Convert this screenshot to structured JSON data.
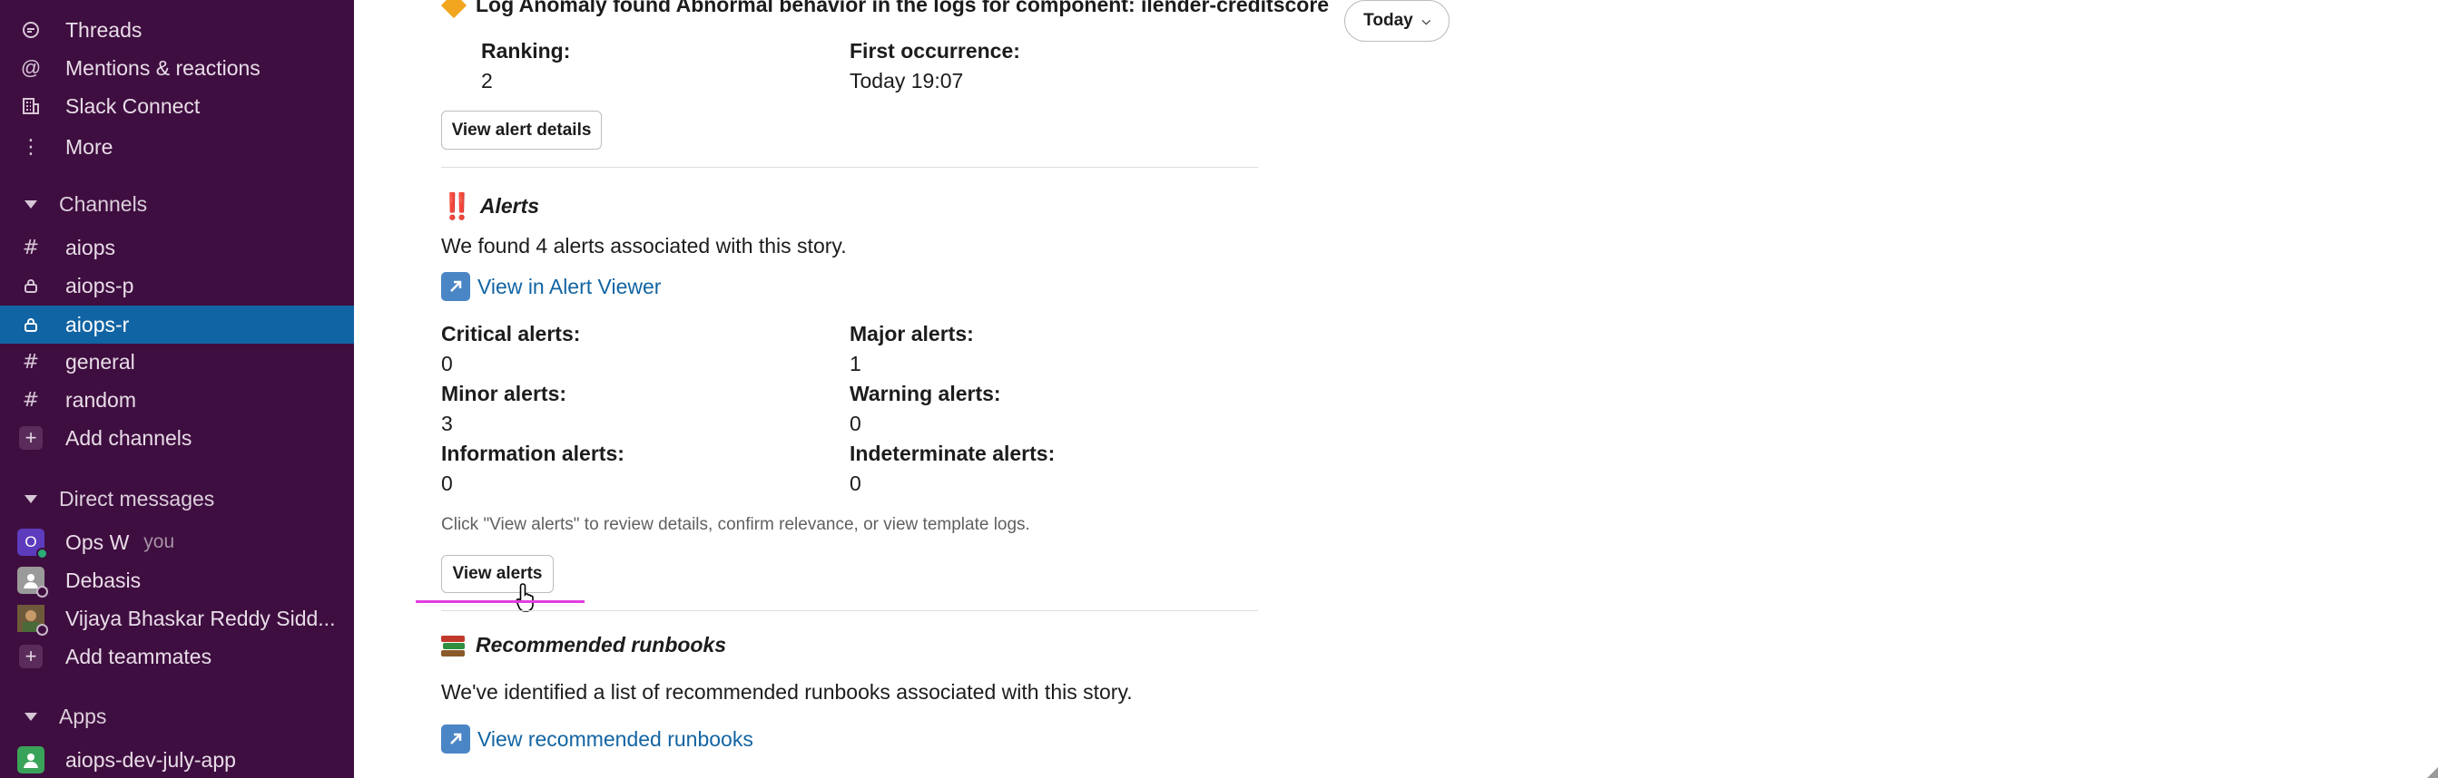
{
  "sidebar": {
    "top_items": [
      {
        "label": "Threads",
        "icon": "threads-icon"
      },
      {
        "label": "Mentions & reactions",
        "icon": "at-icon"
      },
      {
        "label": "Slack Connect",
        "icon": "building-icon"
      },
      {
        "label": "More",
        "icon": "more-vertical-icon"
      }
    ],
    "channels_header": "Channels",
    "channels": [
      {
        "name": "aiops",
        "type": "public"
      },
      {
        "name": "aiops-p",
        "type": "private"
      },
      {
        "name": "aiops-r",
        "type": "private",
        "active": true
      },
      {
        "name": "general",
        "type": "public"
      },
      {
        "name": "random",
        "type": "public"
      }
    ],
    "add_channels": "Add channels",
    "dm_header": "Direct messages",
    "dms": [
      {
        "name": "Ops W",
        "suffix": "you",
        "avatar_letter": "O"
      },
      {
        "name": "Debasis"
      },
      {
        "name": "Vijaya Bhaskar Reddy Sidd..."
      }
    ],
    "add_teammates": "Add teammates",
    "apps_header": "Apps",
    "apps": [
      {
        "name": "aiops-dev-july-app"
      }
    ]
  },
  "main": {
    "anomaly_title": "Log Anomaly found Abnormal behavior in the logs for component: ilender-creditscore",
    "ranking_label": "Ranking:",
    "ranking_value": "2",
    "first_occurrence_label": "First occurrence:",
    "first_occurrence_value": "Today 19:07",
    "view_alert_details": "View alert details",
    "date_pill": "Today",
    "alerts": {
      "emoji": "‼️",
      "title": "Alerts",
      "summary": "We found 4 alerts associated with this story.",
      "viewer_link": "View in Alert Viewer",
      "critical_label": "Critical alerts:",
      "critical_value": "0",
      "major_label": "Major alerts:",
      "major_value": "1",
      "minor_label": "Minor alerts:",
      "minor_value": "3",
      "warning_label": "Warning alerts:",
      "warning_value": "0",
      "info_label": "Information alerts:",
      "info_value": "0",
      "indeterminate_label": "Indeterminate alerts:",
      "indeterminate_value": "0",
      "hint": "Click \"View alerts\" to review details, confirm relevance, or view template logs.",
      "view_alerts": "View alerts"
    },
    "runbooks": {
      "emoji": "📚",
      "title": "Recommended runbooks",
      "summary": "We've identified a list of recommended runbooks associated with this story.",
      "link": "View recommended runbooks"
    }
  },
  "colors": {
    "sidebar_bg": "#3f0e40",
    "active_channel": "#1164a3",
    "link": "#1264a3",
    "underline_highlight": "#e03ee0"
  }
}
